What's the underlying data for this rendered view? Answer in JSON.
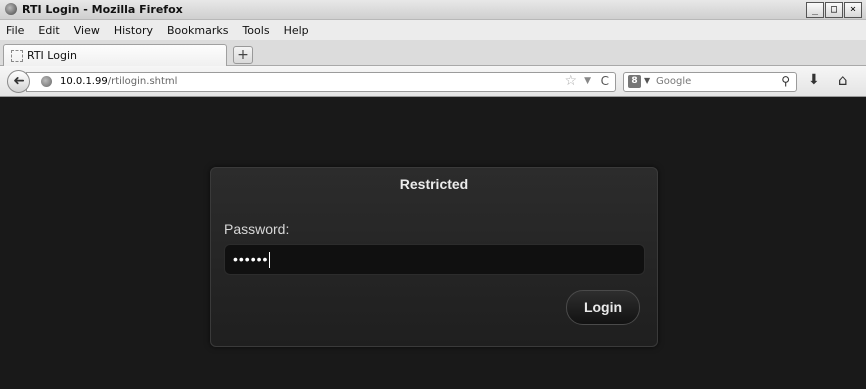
{
  "window": {
    "title": "RTI Login - Mozilla Firefox",
    "minimize": "_",
    "maximize": "□",
    "close": "×"
  },
  "menu": [
    "File",
    "Edit",
    "View",
    "History",
    "Bookmarks",
    "Tools",
    "Help"
  ],
  "tab": {
    "label": "RTI Login",
    "new_tab": "+"
  },
  "nav": {
    "url_host": "10.0.1.99",
    "url_path": "/rtilogin.shtml",
    "search_engine_letter": "8",
    "search_placeholder": "Google",
    "icons": {
      "back": "back-arrow-icon",
      "globe": "globe-icon",
      "bookmark": "star-icon",
      "history": "dropdown-icon",
      "reload": "reload-icon",
      "search": "magnifier-icon",
      "downloads": "downloads-icon",
      "home": "home-icon"
    }
  },
  "page": {
    "panel_title": "Restricted",
    "password_label": "Password:",
    "password_value": "••••••",
    "login_button": "Login",
    "colors": {
      "background": "#191919",
      "panel": "#262626",
      "field": "#101010"
    }
  }
}
